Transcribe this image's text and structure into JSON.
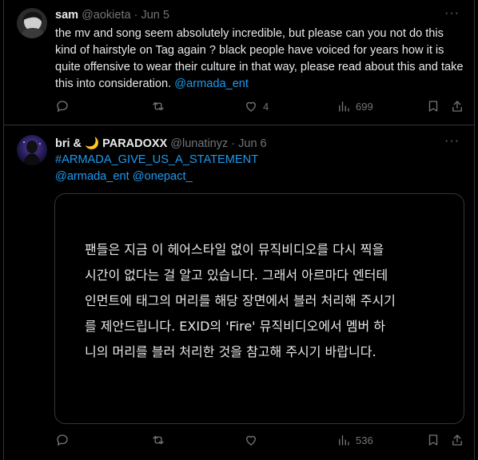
{
  "tweets": [
    {
      "name": "sam",
      "handle": "@aokieta",
      "sep": "·",
      "date": "Jun 5",
      "text": "the mv and song seem absolutely incredible, but please can you not do this kind of hairstyle on Tag again ? black people have voiced for years how it is quite offensive to wear their culture in that way, please read about this and take this into consideration.",
      "mention": "@armada_ent",
      "more": "···",
      "reply_count": "",
      "retweet_count": "",
      "like_count": "4",
      "views_count": "699"
    },
    {
      "name": "bri & 🌙 PARADOXX",
      "handle": "@lunatinyz",
      "sep": "·",
      "date": "Jun 6",
      "hashtag": "#ARMADA_GIVE_US_A_STATEMENT",
      "mention1": "@armada_ent",
      "mention2": "@onepact_",
      "more": "···",
      "card_lines": [
        "팬들은 지금 이 헤어스타일 없이 뮤직비디오를 다시 찍을",
        "시간이 없다는 걸 알고 있습니다. 그래서 아르마다 엔터테",
        "인먼트에 태그의 머리를 해당 장면에서 블러 처리해 주시기",
        "를 제안드립니다. EXID의 'Fire' 뮤직비디오에서 멤버 하",
        "니의 머리를 블러 처리한 것을 참고해 주시기 바랍니다."
      ],
      "reply_count": "",
      "retweet_count": "",
      "like_count": "",
      "views_count": "536"
    }
  ],
  "icons": [
    "reply-icon",
    "retweet-icon",
    "like-icon",
    "views-icon",
    "bookmark-icon",
    "share-icon"
  ],
  "colors": {
    "background": "#000000",
    "text": "#e7e9ea",
    "muted": "#71767b",
    "link": "#1d9bf0",
    "border": "#2f3336"
  }
}
